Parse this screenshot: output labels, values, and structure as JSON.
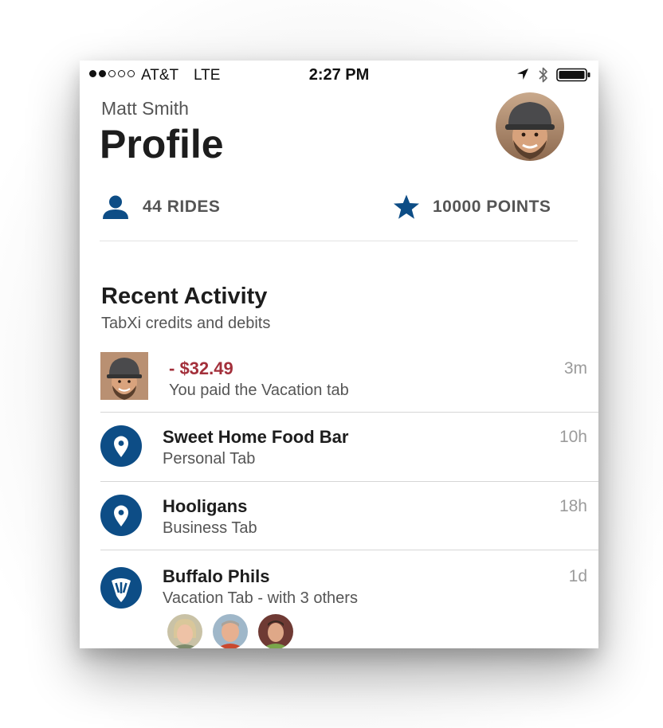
{
  "status_bar": {
    "carrier": "AT&T",
    "network": "LTE",
    "time": "2:27 PM",
    "signal_bars": [
      true,
      true,
      false,
      false,
      false
    ],
    "icons": [
      "location-arrow-icon",
      "bluetooth-icon",
      "battery-icon"
    ]
  },
  "header": {
    "user_name": "Matt Smith",
    "title": "Profile",
    "avatar": "profile-avatar"
  },
  "stats": {
    "rides": {
      "label": "44 RIDES",
      "icon": "person-icon"
    },
    "points": {
      "label": "10000 POINTS",
      "icon": "star-icon"
    }
  },
  "activity": {
    "title": "Recent Activity",
    "subtitle": "TabXi credits and debits",
    "items": [
      {
        "amount": "- $32.49",
        "subtitle": "You paid the Vacation tab",
        "time": "3m",
        "icon": "user-photo"
      },
      {
        "title": "Sweet Home Food Bar",
        "subtitle": "Personal Tab",
        "time": "10h",
        "icon": "map-pin-icon"
      },
      {
        "title": "Hooligans",
        "subtitle": "Business Tab",
        "time": "18h",
        "icon": "map-pin-icon"
      },
      {
        "title": "Buffalo Phils",
        "subtitle": "Vacation Tab - with 3 others",
        "time": "1d",
        "icon": "vacation-badge-icon",
        "members": 3
      }
    ]
  },
  "colors": {
    "accent": "#0d4d86",
    "debit": "#a3303b",
    "text_primary": "#1d1d1d",
    "text_secondary": "#555555",
    "text_muted": "#9b9b9b"
  }
}
